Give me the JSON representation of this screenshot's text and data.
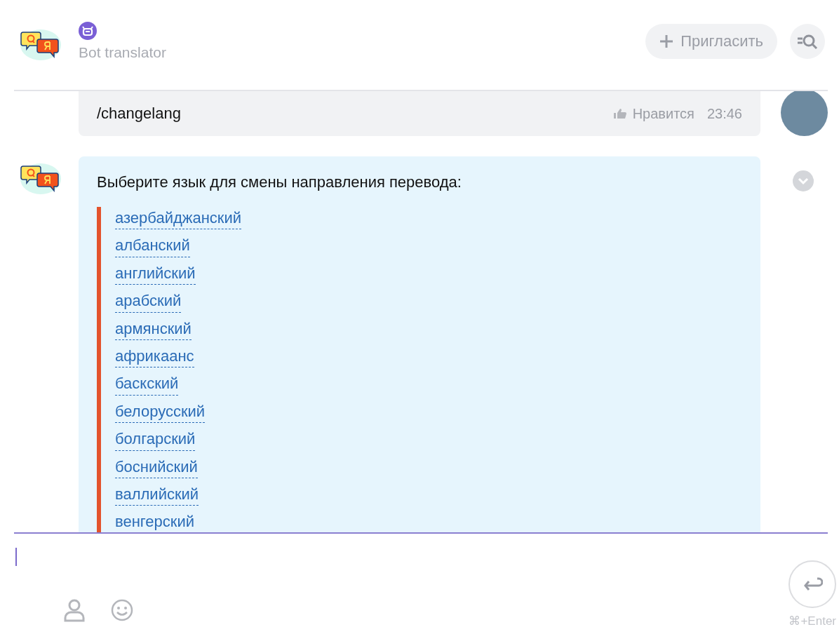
{
  "header": {
    "bot_name": "Bot translator",
    "invite_button": "Пригласить"
  },
  "messages": [
    {
      "kind": "user",
      "text": "/changelang",
      "like": "Нравится",
      "time": "23:46"
    },
    {
      "kind": "bot",
      "text": "Выберите язык для смены направления перевода:",
      "options": [
        "азербайджанский",
        "албанский",
        "английский",
        "арабский",
        "армянский",
        "африкаанс",
        "баскский",
        "белорусский",
        "болгарский",
        "боснийский",
        "валлийский",
        "венгерский"
      ]
    }
  ],
  "composer": {
    "send_hint": "⌘+Enter"
  }
}
